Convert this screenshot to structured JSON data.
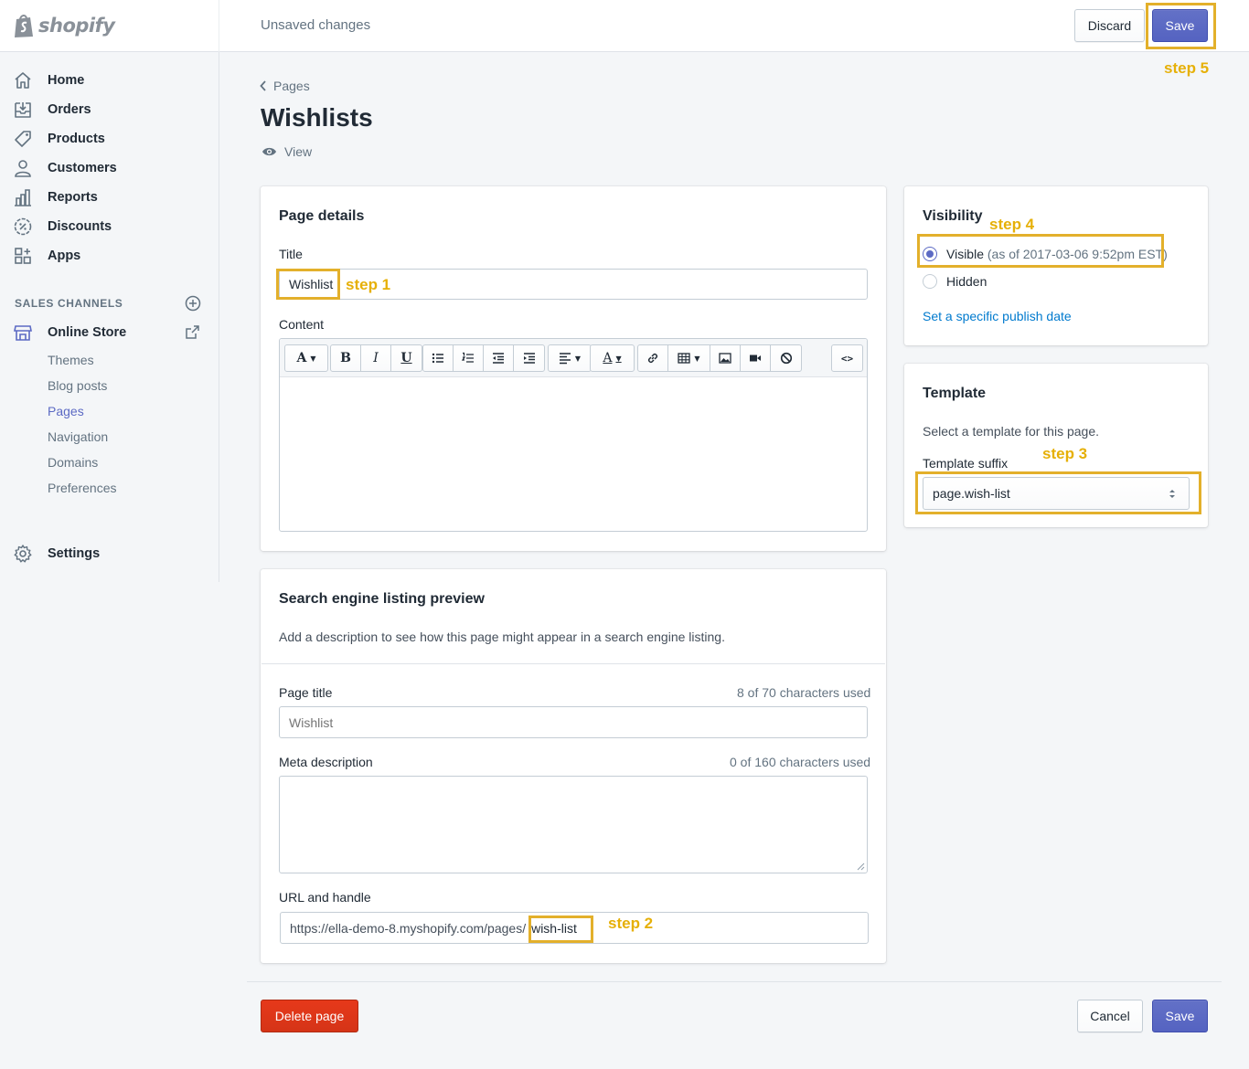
{
  "app": {
    "logo_text": "shopify",
    "status": "Unsaved changes"
  },
  "topbar": {
    "discard_label": "Discard",
    "save_label": "Save"
  },
  "sidebar": {
    "items": [
      {
        "label": "Home",
        "icon": "home-icon"
      },
      {
        "label": "Orders",
        "icon": "orders-icon"
      },
      {
        "label": "Products",
        "icon": "products-icon"
      },
      {
        "label": "Customers",
        "icon": "customers-icon"
      },
      {
        "label": "Reports",
        "icon": "reports-icon"
      },
      {
        "label": "Discounts",
        "icon": "discounts-icon"
      },
      {
        "label": "Apps",
        "icon": "apps-icon"
      }
    ],
    "sales_channels_title": "SALES CHANNELS",
    "online_store_label": "Online Store",
    "sub_items": [
      "Themes",
      "Blog posts",
      "Pages",
      "Navigation",
      "Domains",
      "Preferences"
    ],
    "active_sub_item": "Pages",
    "settings_label": "Settings"
  },
  "page": {
    "breadcrumb": "Pages",
    "title": "Wishlists",
    "view_label": "View"
  },
  "page_details": {
    "heading": "Page details",
    "title_label": "Title",
    "title_value": "Wishlist",
    "content_label": "Content"
  },
  "seo": {
    "heading": "Search engine listing preview",
    "description": "Add a description to see how this page might appear in a search engine listing.",
    "page_title_label": "Page title",
    "page_title_count": "8 of 70 characters used",
    "page_title_placeholder": "Wishlist",
    "meta_label": "Meta description",
    "meta_count": "0 of 160 characters used",
    "url_label": "URL and handle",
    "url_prefix": "https://ella-demo-8.myshopify.com/pages/",
    "handle_value": "wish-list"
  },
  "visibility": {
    "heading": "Visibility",
    "visible_label": "Visible",
    "visible_note": "(as of 2017-03-06 9:52pm EST)",
    "hidden_label": "Hidden",
    "selected": "Visible",
    "publish_link": "Set a specific publish date"
  },
  "template": {
    "heading": "Template",
    "description": "Select a template for this page.",
    "suffix_label": "Template suffix",
    "suffix_value": "page.wish-list"
  },
  "footer": {
    "delete_label": "Delete page",
    "cancel_label": "Cancel",
    "save_label": "Save"
  },
  "annotations": {
    "step1": "step 1",
    "step2": "step 2",
    "step3": "step 3",
    "step4": "step 4",
    "step5": "step 5"
  },
  "colors": {
    "primary": "#5c6ac4",
    "danger": "#de3618",
    "highlight": "#e3b02b",
    "link": "#007ace"
  }
}
